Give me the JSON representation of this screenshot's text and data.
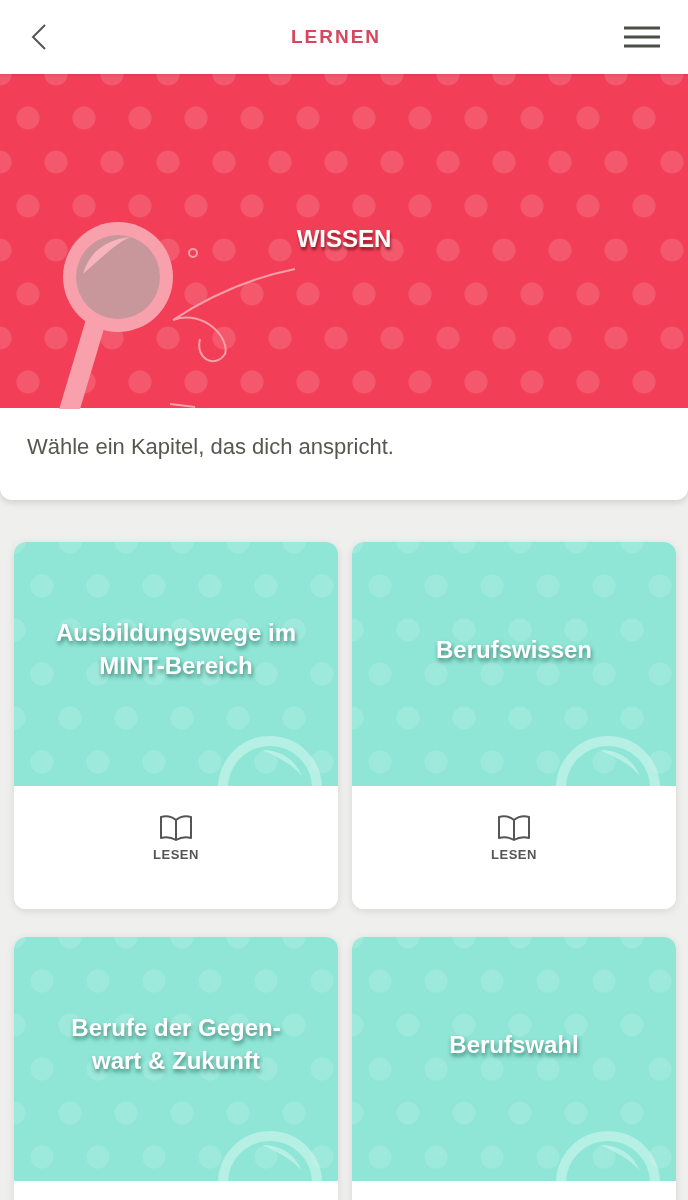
{
  "header": {
    "title": "LERNEN"
  },
  "hero": {
    "title": "WISSEN"
  },
  "intro": {
    "text": "Wähle ein Kapitel, das dich anspricht."
  },
  "chapters": [
    {
      "title": "Ausbildungswege im MINT-Bereich",
      "action": "LESEN"
    },
    {
      "title": "Berufswissen",
      "action": "LESEN"
    },
    {
      "title": "Berufe der Gegen-\nwart & Zukunft"
    },
    {
      "title": "Berufswahl"
    }
  ]
}
